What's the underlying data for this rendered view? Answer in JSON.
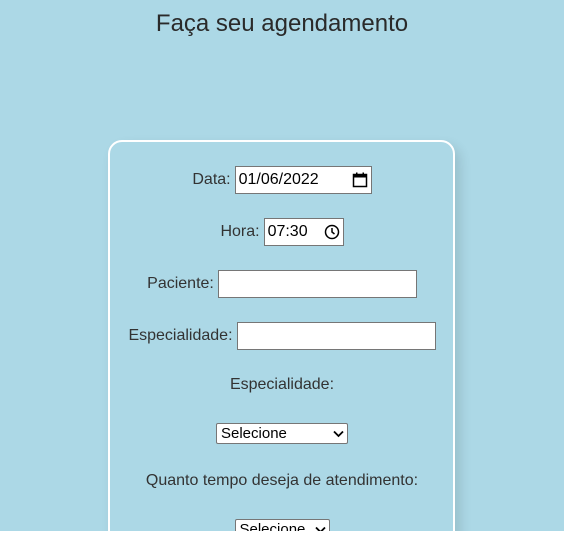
{
  "page": {
    "title": "Faça seu agendamento"
  },
  "form": {
    "data_label": "Data:",
    "data_value": "01/06/2022",
    "hora_label": "Hora:",
    "hora_value": "07:30",
    "paciente_label": "Paciente:",
    "paciente_value": "",
    "especialidade_label": "Especialidade:",
    "especialidade_value": "",
    "especialidade_select_label": "Especialidade:",
    "especialidade_select_value": "Selecione",
    "tempo_label": "Quanto tempo deseja de atendimento:",
    "tempo_select_value": "Selecione"
  },
  "icons": {
    "date": "calendar-icon",
    "time": "clock-icon",
    "dropdown": "chevron-down-icon"
  },
  "colors": {
    "background": "#acd8e6",
    "card_border": "#ffffff",
    "text": "#333333"
  }
}
